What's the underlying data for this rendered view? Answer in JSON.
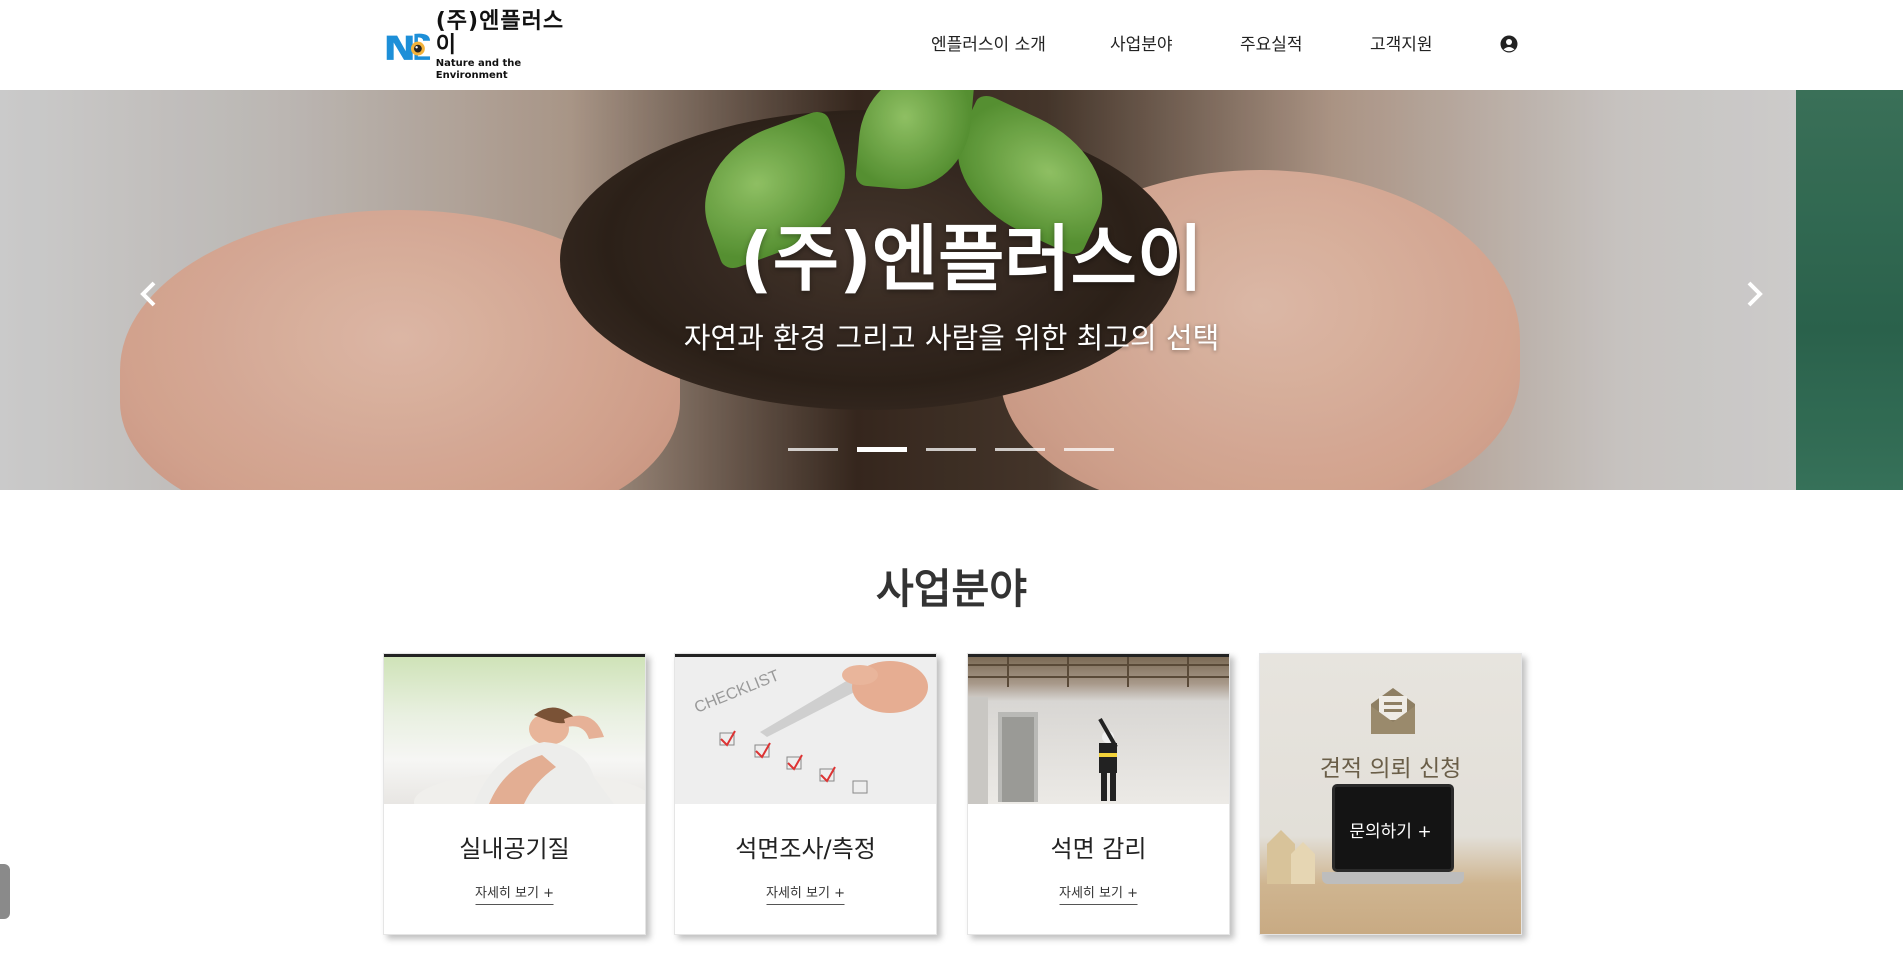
{
  "brand": {
    "name": "(주)엔플러스이",
    "tagline": "Nature and the Environment",
    "colors": {
      "logo_blue": "#1d8fd8",
      "logo_orange": "#e08a1e"
    }
  },
  "nav": {
    "items": [
      {
        "label": "엔플러스이 소개"
      },
      {
        "label": "사업분야"
      },
      {
        "label": "주요실적"
      },
      {
        "label": "고객지원"
      }
    ],
    "user_icon": "user-circle-icon"
  },
  "hero": {
    "title": "(주)엔플러스이",
    "subtitle": "자연과 환경 그리고 사람을 위한 최고의 선택",
    "prev_icon": "chevron-left-icon",
    "next_icon": "chevron-right-icon",
    "slide_count": 5,
    "active_slide": 2
  },
  "section": {
    "title": "사업분야",
    "cards": [
      {
        "title": "실내공기질",
        "more": "자세히 보기 +"
      },
      {
        "title": "석면조사/측정",
        "more": "자세히 보기 +"
      },
      {
        "title": "석면 감리",
        "more": "자세히 보기 +"
      }
    ],
    "quote": {
      "title": "견적 의뢰 신청",
      "button": "문의하기 +",
      "icon": "envelope-icon"
    }
  }
}
